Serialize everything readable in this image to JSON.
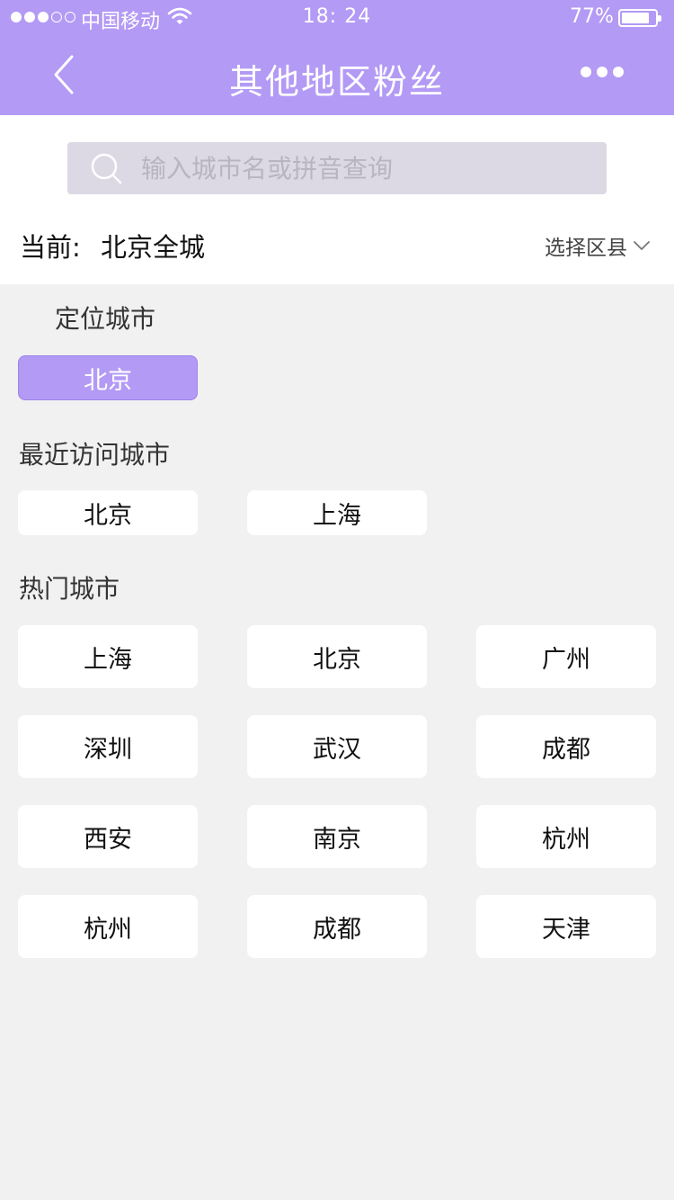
{
  "status_bar": {
    "carrier": "中国移动",
    "time": "18: 24",
    "battery_percent": "77%",
    "battery_level": 0.77,
    "signal_bars_filled": 3,
    "signal_bars_total": 5
  },
  "nav": {
    "title": "其他地区粉丝",
    "back_icon": "back-chevron-icon",
    "more_icon": "more-dots-icon"
  },
  "search": {
    "placeholder": "输入城市名或拼音查询",
    "value": ""
  },
  "current": {
    "label": "当前:",
    "city": "北京全城",
    "district_select_label": "选择区县"
  },
  "located": {
    "title": "定位城市",
    "city": "北京"
  },
  "recent": {
    "title": "最近访问城市",
    "cities": [
      "北京",
      "上海"
    ]
  },
  "hot": {
    "title": "热门城市",
    "cities": [
      "上海",
      "北京",
      "广州",
      "深圳",
      "武汉",
      "成都",
      "西安",
      "南京",
      "杭州",
      "杭州",
      "成都",
      "天津"
    ]
  },
  "colors": {
    "accent": "#b39af5",
    "background": "#f2f1f2",
    "search_bg": "#dcd8e4"
  }
}
